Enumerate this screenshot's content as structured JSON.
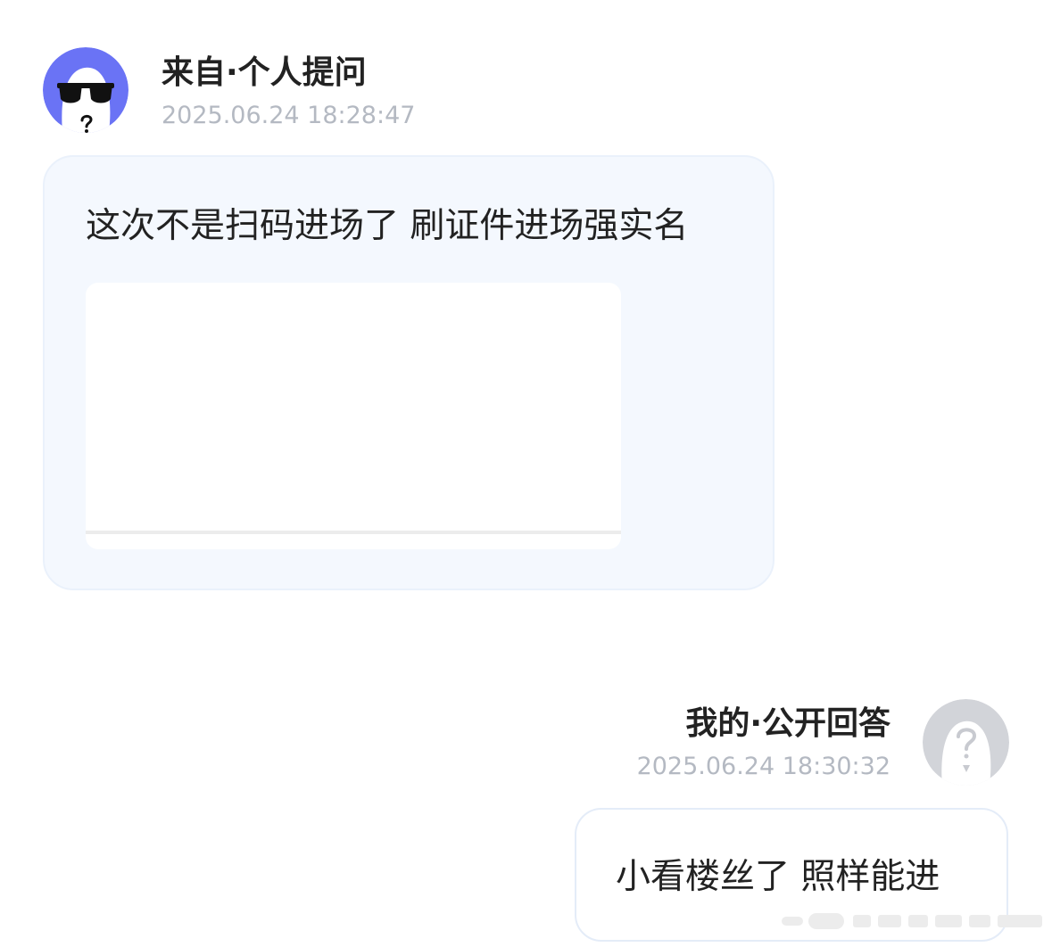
{
  "question": {
    "title": "来自·个人提问",
    "timestamp": "2025.06.24 18:28:47",
    "text": "这次不是扫码进场了 刷证件进场强实名",
    "avatar_icon": "sunglasses-face-avatar-icon",
    "avatar_color": "#6a73f5",
    "bubble_color": "#f4f8fe"
  },
  "answer": {
    "title": "我的·公开回答",
    "timestamp": "2025.06.24 18:30:32",
    "text": "小看楼丝了 照样能进",
    "avatar_icon": "question-mark-avatar-icon",
    "avatar_color": "#d2d4d9"
  }
}
